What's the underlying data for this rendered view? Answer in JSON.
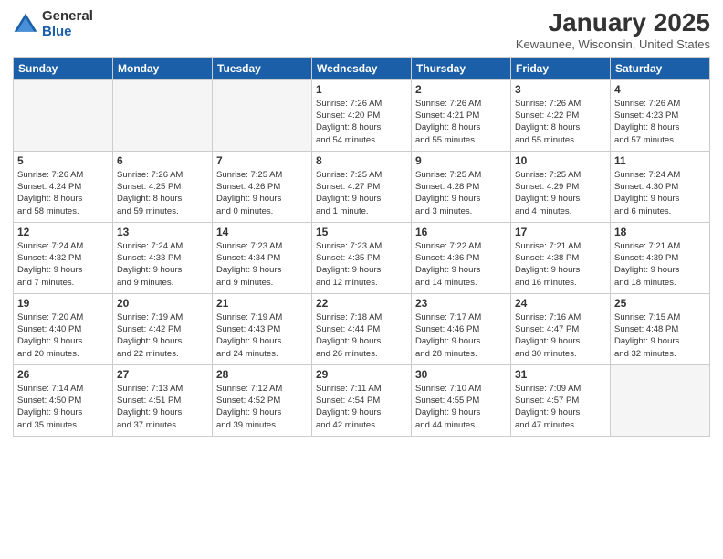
{
  "header": {
    "logo_general": "General",
    "logo_blue": "Blue",
    "month_title": "January 2025",
    "location": "Kewaunee, Wisconsin, United States"
  },
  "weekdays": [
    "Sunday",
    "Monday",
    "Tuesday",
    "Wednesday",
    "Thursday",
    "Friday",
    "Saturday"
  ],
  "weeks": [
    [
      {
        "day": "",
        "info": ""
      },
      {
        "day": "",
        "info": ""
      },
      {
        "day": "",
        "info": ""
      },
      {
        "day": "1",
        "info": "Sunrise: 7:26 AM\nSunset: 4:20 PM\nDaylight: 8 hours\nand 54 minutes."
      },
      {
        "day": "2",
        "info": "Sunrise: 7:26 AM\nSunset: 4:21 PM\nDaylight: 8 hours\nand 55 minutes."
      },
      {
        "day": "3",
        "info": "Sunrise: 7:26 AM\nSunset: 4:22 PM\nDaylight: 8 hours\nand 55 minutes."
      },
      {
        "day": "4",
        "info": "Sunrise: 7:26 AM\nSunset: 4:23 PM\nDaylight: 8 hours\nand 57 minutes."
      }
    ],
    [
      {
        "day": "5",
        "info": "Sunrise: 7:26 AM\nSunset: 4:24 PM\nDaylight: 8 hours\nand 58 minutes."
      },
      {
        "day": "6",
        "info": "Sunrise: 7:26 AM\nSunset: 4:25 PM\nDaylight: 8 hours\nand 59 minutes."
      },
      {
        "day": "7",
        "info": "Sunrise: 7:25 AM\nSunset: 4:26 PM\nDaylight: 9 hours\nand 0 minutes."
      },
      {
        "day": "8",
        "info": "Sunrise: 7:25 AM\nSunset: 4:27 PM\nDaylight: 9 hours\nand 1 minute."
      },
      {
        "day": "9",
        "info": "Sunrise: 7:25 AM\nSunset: 4:28 PM\nDaylight: 9 hours\nand 3 minutes."
      },
      {
        "day": "10",
        "info": "Sunrise: 7:25 AM\nSunset: 4:29 PM\nDaylight: 9 hours\nand 4 minutes."
      },
      {
        "day": "11",
        "info": "Sunrise: 7:24 AM\nSunset: 4:30 PM\nDaylight: 9 hours\nand 6 minutes."
      }
    ],
    [
      {
        "day": "12",
        "info": "Sunrise: 7:24 AM\nSunset: 4:32 PM\nDaylight: 9 hours\nand 7 minutes."
      },
      {
        "day": "13",
        "info": "Sunrise: 7:24 AM\nSunset: 4:33 PM\nDaylight: 9 hours\nand 9 minutes."
      },
      {
        "day": "14",
        "info": "Sunrise: 7:23 AM\nSunset: 4:34 PM\nDaylight: 9 hours\nand 9 minutes."
      },
      {
        "day": "15",
        "info": "Sunrise: 7:23 AM\nSunset: 4:35 PM\nDaylight: 9 hours\nand 12 minutes."
      },
      {
        "day": "16",
        "info": "Sunrise: 7:22 AM\nSunset: 4:36 PM\nDaylight: 9 hours\nand 14 minutes."
      },
      {
        "day": "17",
        "info": "Sunrise: 7:21 AM\nSunset: 4:38 PM\nDaylight: 9 hours\nand 16 minutes."
      },
      {
        "day": "18",
        "info": "Sunrise: 7:21 AM\nSunset: 4:39 PM\nDaylight: 9 hours\nand 18 minutes."
      }
    ],
    [
      {
        "day": "19",
        "info": "Sunrise: 7:20 AM\nSunset: 4:40 PM\nDaylight: 9 hours\nand 20 minutes."
      },
      {
        "day": "20",
        "info": "Sunrise: 7:19 AM\nSunset: 4:42 PM\nDaylight: 9 hours\nand 22 minutes."
      },
      {
        "day": "21",
        "info": "Sunrise: 7:19 AM\nSunset: 4:43 PM\nDaylight: 9 hours\nand 24 minutes."
      },
      {
        "day": "22",
        "info": "Sunrise: 7:18 AM\nSunset: 4:44 PM\nDaylight: 9 hours\nand 26 minutes."
      },
      {
        "day": "23",
        "info": "Sunrise: 7:17 AM\nSunset: 4:46 PM\nDaylight: 9 hours\nand 28 minutes."
      },
      {
        "day": "24",
        "info": "Sunrise: 7:16 AM\nSunset: 4:47 PM\nDaylight: 9 hours\nand 30 minutes."
      },
      {
        "day": "25",
        "info": "Sunrise: 7:15 AM\nSunset: 4:48 PM\nDaylight: 9 hours\nand 32 minutes."
      }
    ],
    [
      {
        "day": "26",
        "info": "Sunrise: 7:14 AM\nSunset: 4:50 PM\nDaylight: 9 hours\nand 35 minutes."
      },
      {
        "day": "27",
        "info": "Sunrise: 7:13 AM\nSunset: 4:51 PM\nDaylight: 9 hours\nand 37 minutes."
      },
      {
        "day": "28",
        "info": "Sunrise: 7:12 AM\nSunset: 4:52 PM\nDaylight: 9 hours\nand 39 minutes."
      },
      {
        "day": "29",
        "info": "Sunrise: 7:11 AM\nSunset: 4:54 PM\nDaylight: 9 hours\nand 42 minutes."
      },
      {
        "day": "30",
        "info": "Sunrise: 7:10 AM\nSunset: 4:55 PM\nDaylight: 9 hours\nand 44 minutes."
      },
      {
        "day": "31",
        "info": "Sunrise: 7:09 AM\nSunset: 4:57 PM\nDaylight: 9 hours\nand 47 minutes."
      },
      {
        "day": "",
        "info": ""
      }
    ]
  ]
}
